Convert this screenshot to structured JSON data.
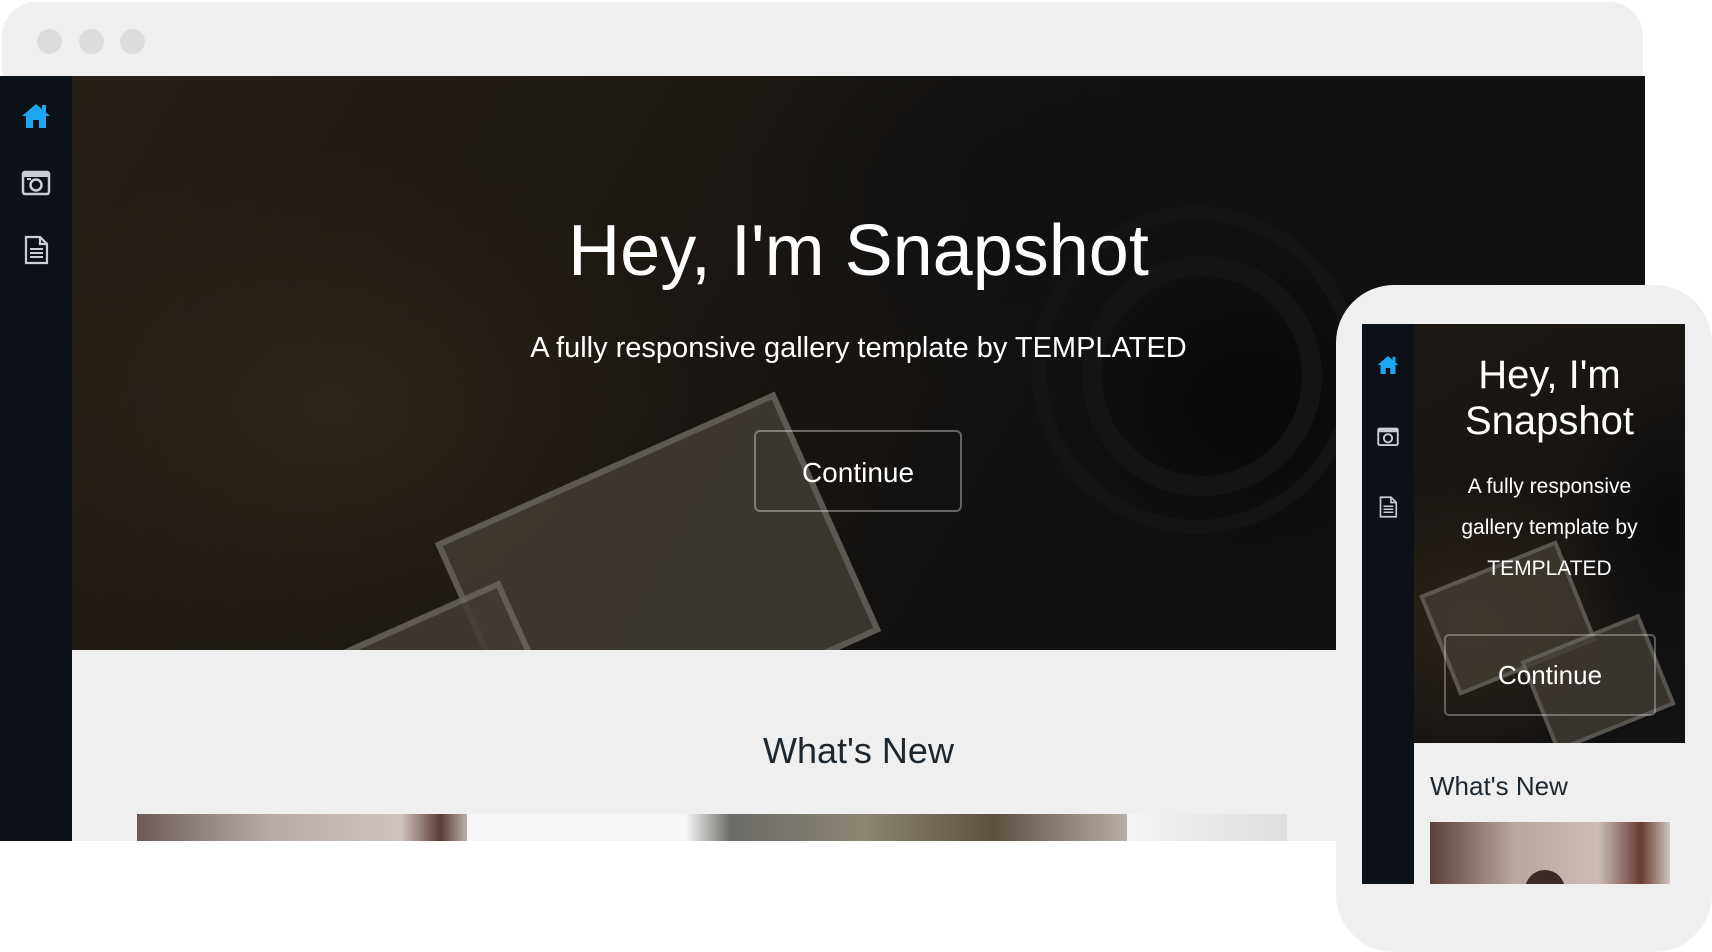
{
  "desktop": {
    "sidebar": {
      "items": [
        {
          "icon": "home-icon",
          "active": true
        },
        {
          "icon": "camera-icon",
          "active": false
        },
        {
          "icon": "document-icon",
          "active": false
        }
      ]
    },
    "hero": {
      "title": "Hey, I'm Snapshot",
      "subtitle": "A fully responsive gallery template by TEMPLATED",
      "button_label": "Continue"
    },
    "section_title": "What's New"
  },
  "mobile": {
    "sidebar": {
      "items": [
        {
          "icon": "home-icon",
          "active": true
        },
        {
          "icon": "camera-icon",
          "active": false
        },
        {
          "icon": "document-icon",
          "active": false
        }
      ]
    },
    "hero": {
      "title": "Hey, I'm Snapshot",
      "subtitle": "A fully responsive gallery template by TEMPLATED",
      "button_label": "Continue"
    },
    "section_title": "What's New"
  },
  "colors": {
    "accent": "#1ea7f0",
    "sidebar_bg": "#0c1117",
    "page_bg": "#efefef",
    "icon_muted": "#c9ced3"
  }
}
